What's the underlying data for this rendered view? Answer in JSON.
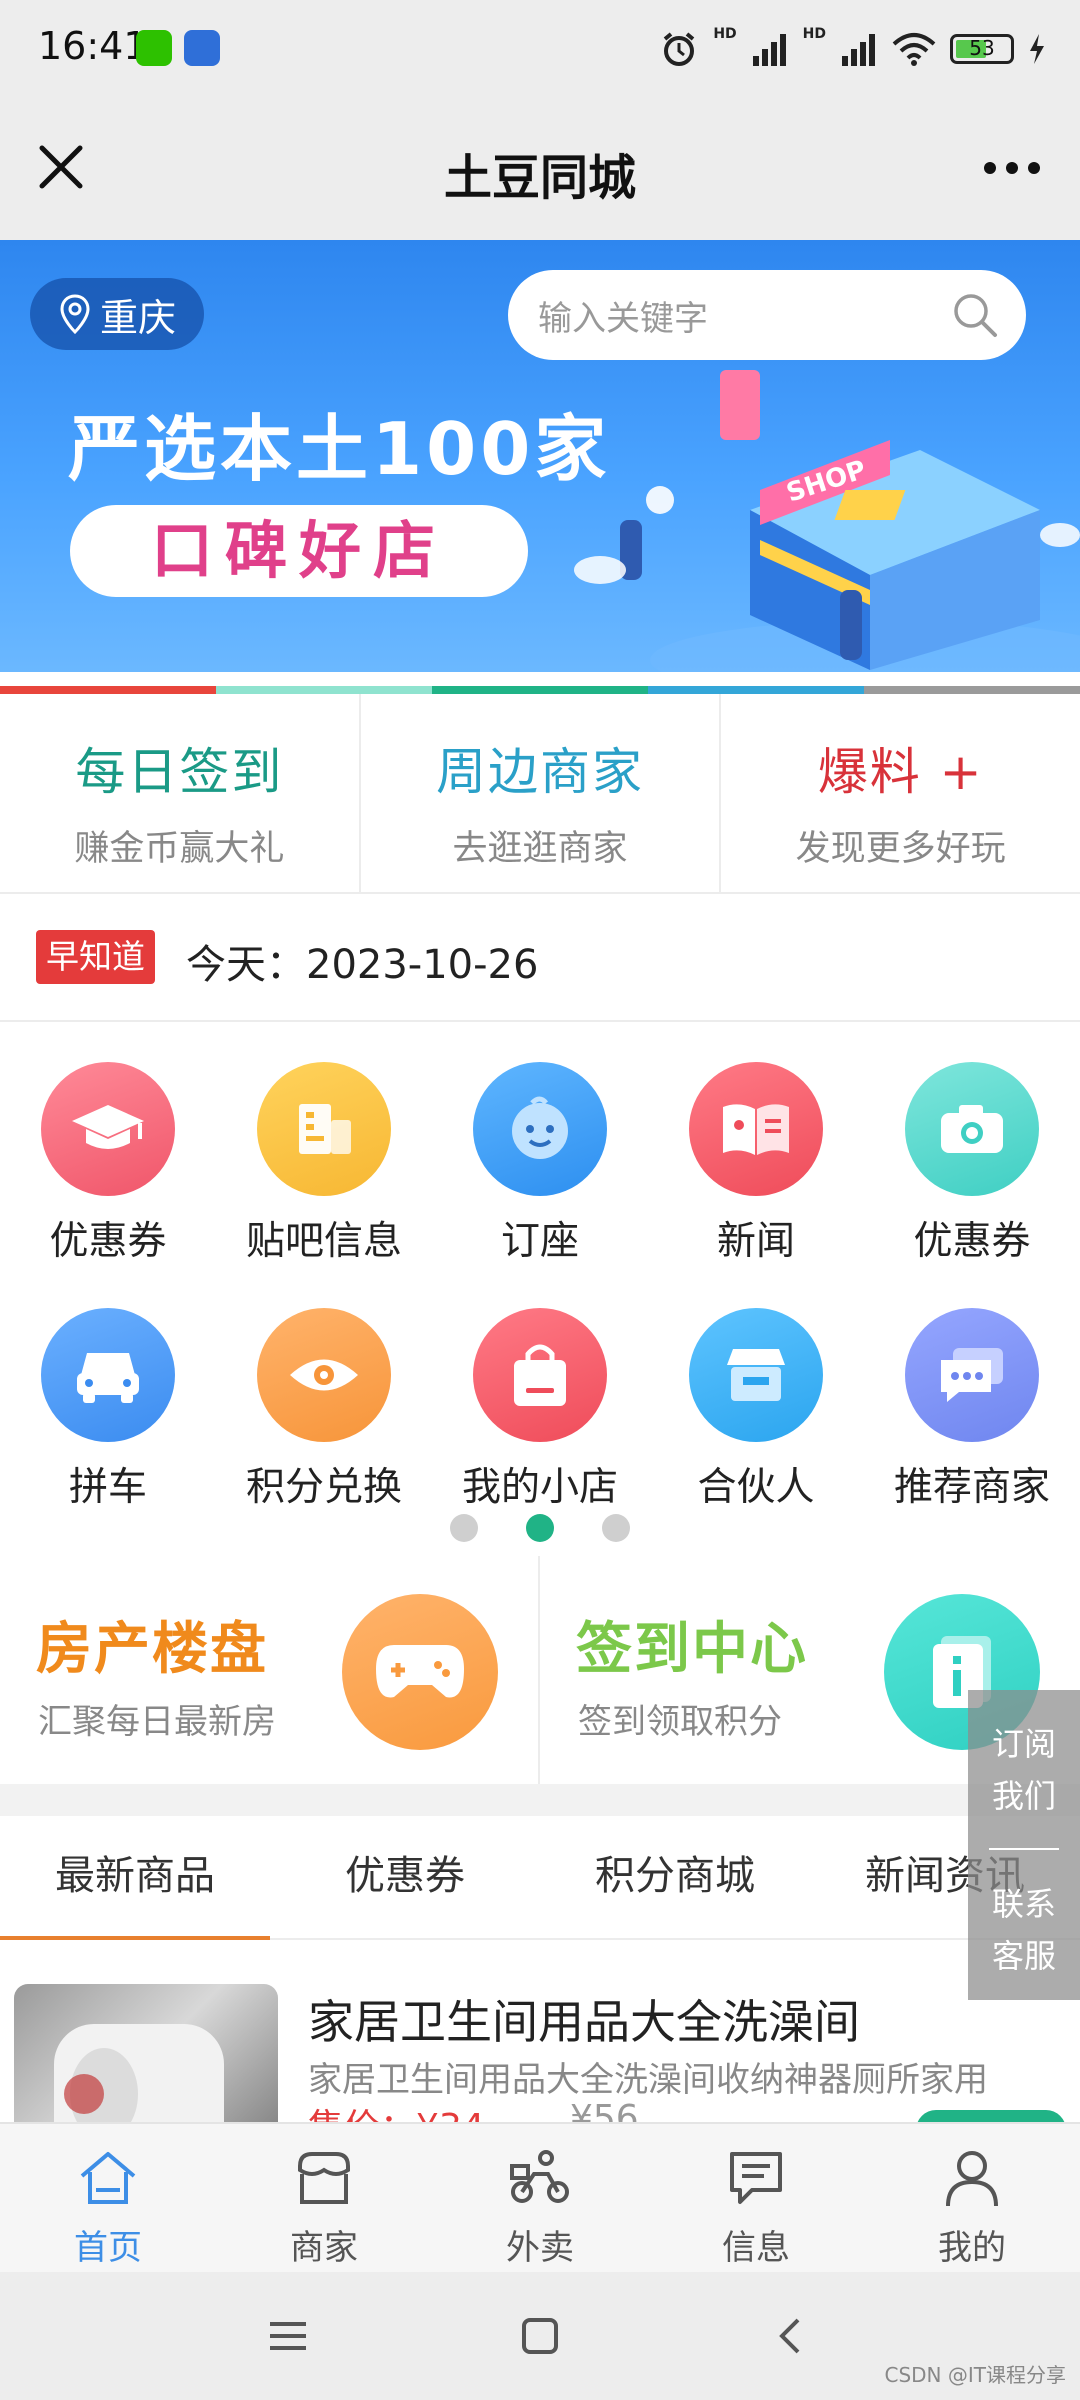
{
  "status_bar": {
    "time": "16:41",
    "battery": "53",
    "signal_1": "HD",
    "signal_2": "HD"
  },
  "titlebar": {
    "title": "土豆同城"
  },
  "banner": {
    "location": "重庆",
    "search_placeholder": "输入关键字",
    "headline": "严选本土100家",
    "pill_text": "口碑好店",
    "shop_sign": "SHOP"
  },
  "strip_colors": [
    "#e8453c",
    "#8fe3cf",
    "#20b386",
    "#33a6d8",
    "#9a9a9a"
  ],
  "quick_cards": [
    {
      "title": "每日签到",
      "subtitle": "赚金币赢大礼",
      "color": "#1a9a86"
    },
    {
      "title": "周边商家",
      "subtitle": "去逛逛商家",
      "color": "#2aa0c8"
    },
    {
      "title": "爆料 +",
      "subtitle": "发现更多好玩",
      "color": "#d8323a"
    }
  ],
  "ticker": {
    "tag": "早知道",
    "text": "今天：2023-10-26"
  },
  "grid_items": [
    {
      "label": "优惠券",
      "icon": "graduation-cap-icon",
      "color": "#f0566a"
    },
    {
      "label": "贴吧信息",
      "icon": "building-icon",
      "color": "#f7b733"
    },
    {
      "label": "订座",
      "icon": "baby-face-icon",
      "color": "#2d8ff0"
    },
    {
      "label": "新闻",
      "icon": "book-icon",
      "color": "#ef4c5a"
    },
    {
      "label": "优惠券",
      "icon": "camera-icon",
      "color": "#3fcfc3"
    },
    {
      "label": "拼车",
      "icon": "car-icon",
      "color": "#3b8cf0"
    },
    {
      "label": "积分兑换",
      "icon": "eye-icon",
      "color": "#f7953a"
    },
    {
      "label": "我的小店",
      "icon": "shopping-bag-icon",
      "color": "#ef4c5a"
    },
    {
      "label": "合伙人",
      "icon": "storefront-icon",
      "color": "#2ba5ef"
    },
    {
      "label": "推荐商家",
      "icon": "chat-bubble-icon",
      "color": "#6f86ef"
    }
  ],
  "page_indicator": {
    "count": 3,
    "active": 1
  },
  "features": [
    {
      "title": "房产楼盘",
      "subtitle": "汇聚每日最新房",
      "color": "#f08a1c",
      "icon": "gamepad-icon",
      "icon_color": "#f99a3e"
    },
    {
      "title": "签到中心",
      "subtitle": "签到领取积分",
      "color": "#7cc84a",
      "icon": "document-icon",
      "icon_color": "#2fd0c2"
    }
  ],
  "floating": {
    "subscribe_1": "订阅",
    "subscribe_2": "我们",
    "service_1": "联系",
    "service_2": "客服"
  },
  "tabs": [
    "最新商品",
    "优惠券",
    "积分商城",
    "新闻资讯"
  ],
  "active_tab": 0,
  "product": {
    "title": "家居卫生间用品大全洗澡间",
    "description": "家居卫生间用品大全洗澡间收纳神器厕所家用",
    "price_label": "售价：¥34",
    "old_price": "¥56"
  },
  "bottom_nav": [
    {
      "label": "首页",
      "icon": "home-icon"
    },
    {
      "label": "商家",
      "icon": "shop-icon"
    },
    {
      "label": "外卖",
      "icon": "delivery-bike-icon"
    },
    {
      "label": "信息",
      "icon": "message-icon"
    },
    {
      "label": "我的",
      "icon": "user-icon"
    }
  ],
  "active_nav": 0,
  "watermark": "CSDN @IT课程分享"
}
